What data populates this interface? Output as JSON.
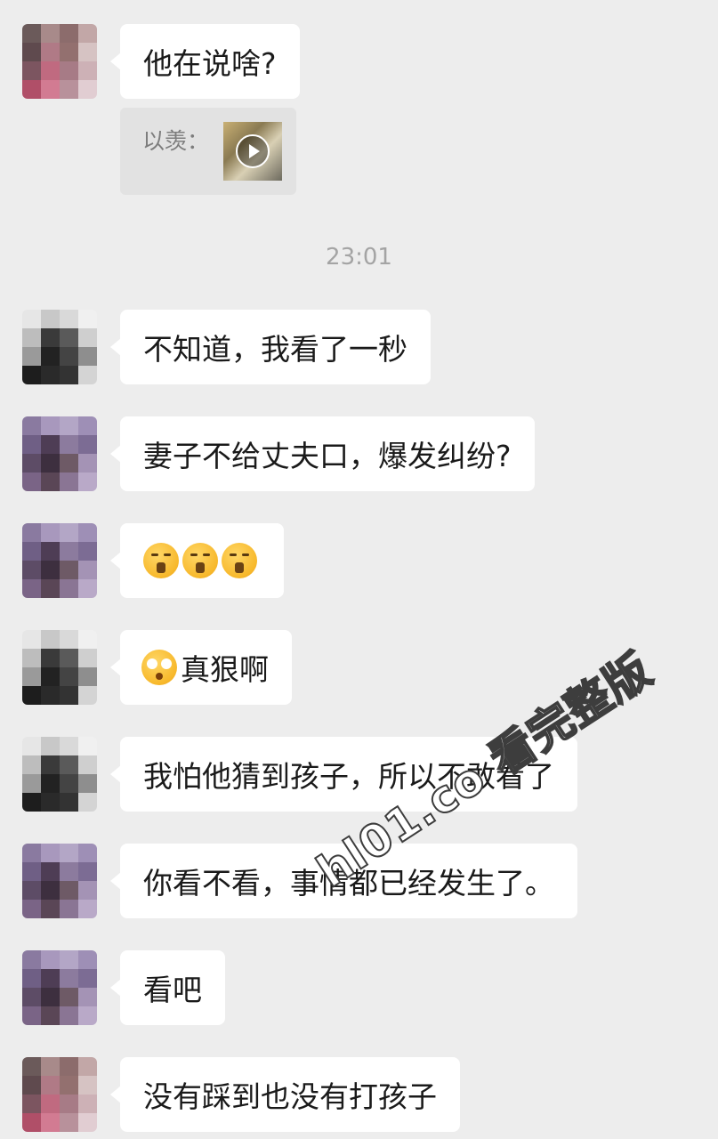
{
  "messages": [
    {
      "text": "他在说啥?"
    },
    {
      "text": "不知道，我看了一秒"
    },
    {
      "text": " 妻子不给丈夫口，爆发纠纷?"
    },
    {
      "text": ""
    },
    {
      "text": "真狠啊"
    },
    {
      "text": "我怕他猜到孩子，所以不敢看了"
    },
    {
      "text": "你看不看，事情都已经发生了。"
    },
    {
      "text": "看吧"
    },
    {
      "text": "没有踩到也没有打孩子"
    }
  ],
  "quote": {
    "label": "以羡："
  },
  "timestamp": "23:01",
  "watermark": "hl01.co 看完整版",
  "colors": {
    "background": "#ededed",
    "bubble": "#ffffff",
    "quote_background": "#e2e2e2",
    "timestamp_text": "#a4a4a4"
  },
  "icons": {
    "sealed_lips_emoji": "face-with-sealed-lips",
    "shocked_emoji": "flushed-face",
    "play_icon": "play-icon"
  }
}
